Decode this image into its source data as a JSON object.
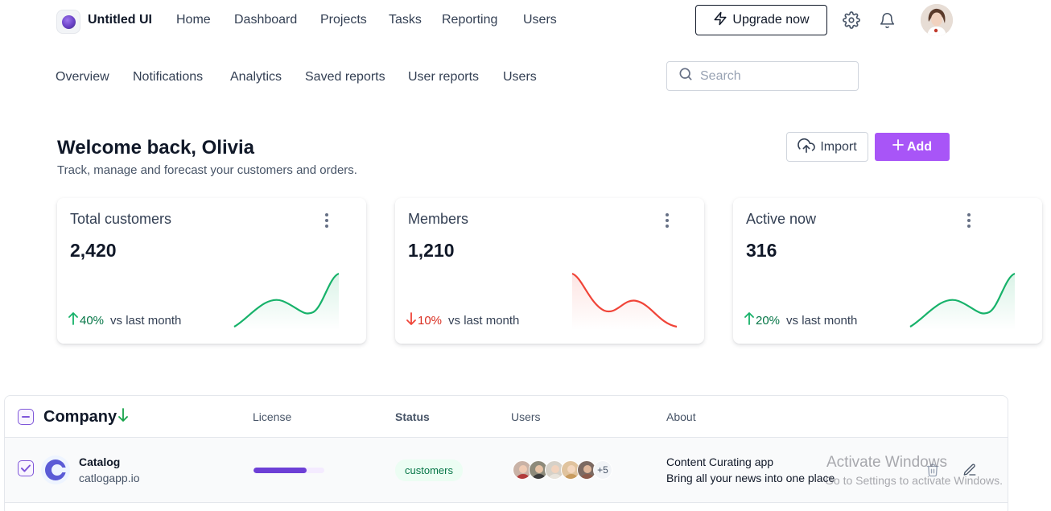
{
  "app": {
    "name": "Untitled UI"
  },
  "top_nav": [
    "Home",
    "Dashboard",
    "Projects",
    "Tasks",
    "Reporting",
    "Users"
  ],
  "upgrade_label": "Upgrade now",
  "sub_nav": [
    "Overview",
    "Notifications",
    "Analytics",
    "Saved reports",
    "User reports",
    "Users"
  ],
  "search": {
    "placeholder": "Search",
    "value": ""
  },
  "header": {
    "title": "Welcome back, Olivia",
    "subtitle": "Track, manage and forecast your customers and orders.",
    "import_label": "Import",
    "add_label": "Add"
  },
  "stats": [
    {
      "title": "Total customers",
      "value": "2,420",
      "change": "40%",
      "direction": "up",
      "caption": "vs last month",
      "color": "#17b26a"
    },
    {
      "title": "Members",
      "value": "1,210",
      "change": "10%",
      "direction": "down",
      "caption": "vs last month",
      "color": "#f04438"
    },
    {
      "title": "Active now",
      "value": "316",
      "change": "20%",
      "direction": "up",
      "caption": "vs last month",
      "color": "#17b26a"
    }
  ],
  "table": {
    "columns": [
      "Company",
      "License",
      "Status",
      "Users",
      "About"
    ],
    "rows": [
      {
        "name": "Catalog",
        "url": "catlogapp.io",
        "license_progress": 0.75,
        "status": "customers",
        "users_extra": "+5",
        "about_title": "Content Curating app",
        "about_desc": "Bring all your news into one place",
        "checked": true
      }
    ]
  },
  "watermark": {
    "line1": "Activate Windows",
    "line2": "Go to Settings to activate Windows."
  },
  "colors": {
    "accent": "#a855f7",
    "brand": "#7f56d9",
    "positive": "#17b26a",
    "negative": "#f04438"
  },
  "icons": [
    "zap-icon",
    "settings-icon",
    "bell-icon",
    "search-icon",
    "upload-cloud-icon",
    "plus-icon",
    "dots-vertical-icon",
    "arrow-up-icon",
    "arrow-down-icon",
    "trash-icon",
    "edit-icon"
  ]
}
